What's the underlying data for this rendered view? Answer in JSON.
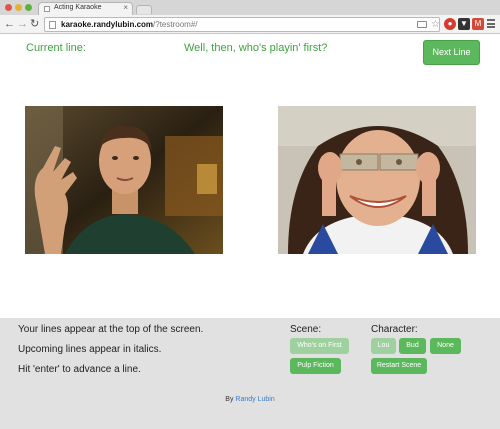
{
  "browser": {
    "tab_title": "Acting Karaoke",
    "url_host": "karaoke.randylubin.com",
    "url_path": "/?testroom#/"
  },
  "header": {
    "current_line_label": "Current line:",
    "current_line_text": "Well, then, who's playin' first?",
    "next_button_label": "Next Line"
  },
  "instructions": [
    "Your lines appear at the top of the screen.",
    "Upcoming lines appear in italics.",
    "Hit 'enter' to advance a line."
  ],
  "scene": {
    "label": "Scene:",
    "options": [
      "Who's on First",
      "Pulp Fiction"
    ],
    "selected": "Who's on First"
  },
  "character": {
    "label": "Character:",
    "options": [
      "Lou",
      "Bud",
      "None"
    ],
    "selected": "Lou",
    "restart_label": "Restart Scene"
  },
  "credit": {
    "prefix": "By",
    "author": "Randy Lubin"
  },
  "colors": {
    "accent_green": "#5cb85c",
    "text_green": "#3da33d",
    "muted_green": "#9fd19f",
    "panel_bg": "#e1e1e1",
    "link": "#3a7bc8"
  }
}
